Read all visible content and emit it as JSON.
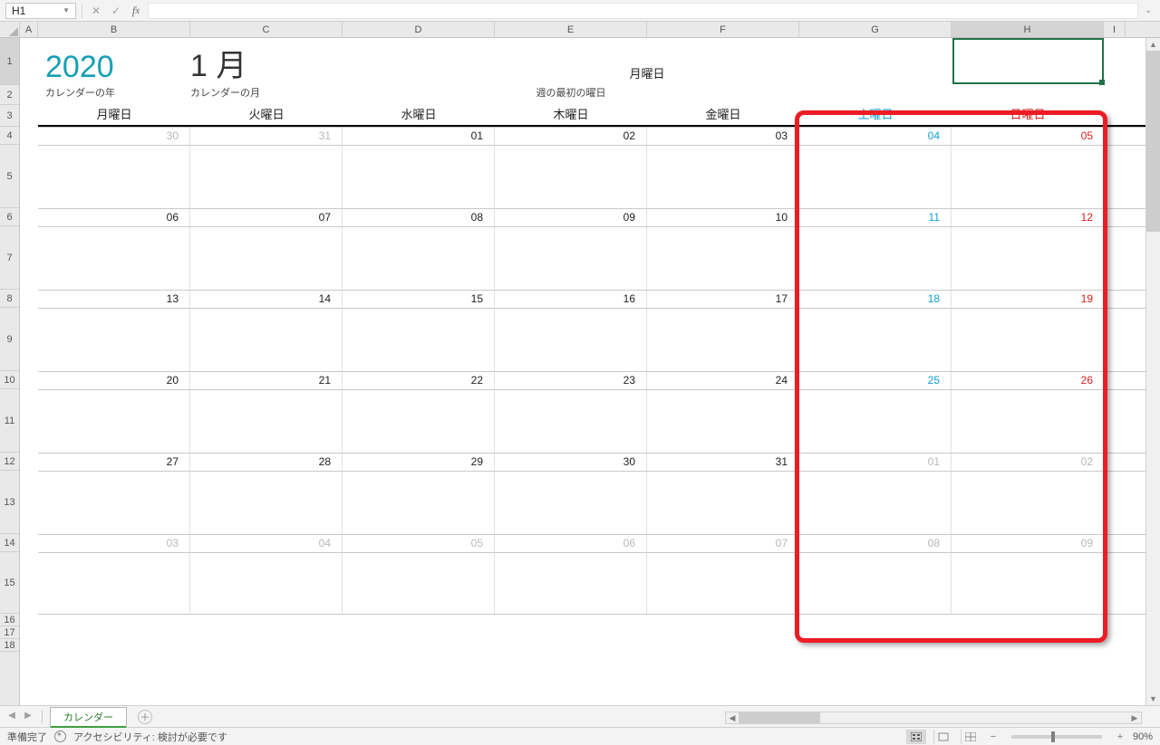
{
  "namebox": {
    "ref": "H1"
  },
  "columns": [
    "A",
    "B",
    "C",
    "D",
    "E",
    "F",
    "G",
    "H",
    "I"
  ],
  "rows": [
    "1",
    "2",
    "3",
    "4",
    "5",
    "6",
    "7",
    "8",
    "9",
    "10",
    "11",
    "12",
    "13",
    "14",
    "15",
    "16",
    "17",
    "18"
  ],
  "title": {
    "year": "2020",
    "year_label": "カレンダーの年",
    "month": "1 月",
    "month_label": "カレンダーの月",
    "first_day_value": "月曜日",
    "first_day_label": "週の最初の曜日"
  },
  "weekdays": [
    "月曜日",
    "火曜日",
    "水曜日",
    "木曜日",
    "金曜日",
    "土曜日",
    "日曜日"
  ],
  "calendar": [
    [
      {
        "d": "30",
        "dim": true
      },
      {
        "d": "31",
        "dim": true
      },
      {
        "d": "01"
      },
      {
        "d": "02"
      },
      {
        "d": "03"
      },
      {
        "d": "04",
        "sat": true
      },
      {
        "d": "05",
        "sun": true
      }
    ],
    [
      {
        "d": "06"
      },
      {
        "d": "07"
      },
      {
        "d": "08"
      },
      {
        "d": "09"
      },
      {
        "d": "10"
      },
      {
        "d": "11",
        "sat": true
      },
      {
        "d": "12",
        "sun": true
      }
    ],
    [
      {
        "d": "13"
      },
      {
        "d": "14"
      },
      {
        "d": "15"
      },
      {
        "d": "16"
      },
      {
        "d": "17"
      },
      {
        "d": "18",
        "sat": true
      },
      {
        "d": "19",
        "sun": true
      }
    ],
    [
      {
        "d": "20"
      },
      {
        "d": "21"
      },
      {
        "d": "22"
      },
      {
        "d": "23"
      },
      {
        "d": "24"
      },
      {
        "d": "25",
        "sat": true
      },
      {
        "d": "26",
        "sun": true
      }
    ],
    [
      {
        "d": "27"
      },
      {
        "d": "28"
      },
      {
        "d": "29"
      },
      {
        "d": "30"
      },
      {
        "d": "31"
      },
      {
        "d": "01",
        "dim": true
      },
      {
        "d": "02",
        "dim": true
      }
    ],
    [
      {
        "d": "03",
        "dim": true
      },
      {
        "d": "04",
        "dim": true
      },
      {
        "d": "05",
        "dim": true
      },
      {
        "d": "06",
        "dim": true
      },
      {
        "d": "07",
        "dim": true
      },
      {
        "d": "08",
        "dim": true
      },
      {
        "d": "09",
        "dim": true
      }
    ]
  ],
  "sheet_tab": "カレンダー",
  "status": {
    "ready": "準備完了",
    "accessibility": "アクセシビリティ: 検討が必要です",
    "zoom": "90%"
  }
}
